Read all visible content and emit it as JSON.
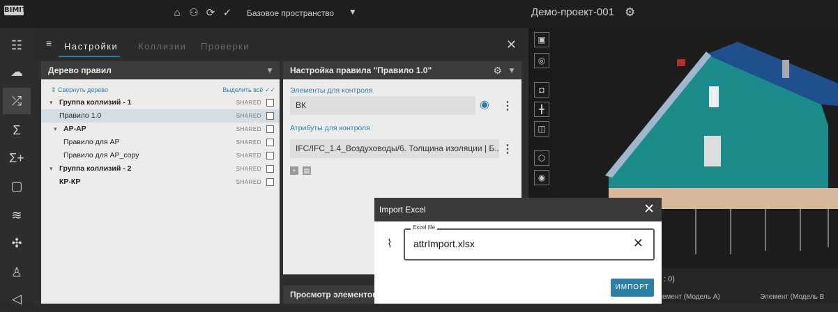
{
  "topbar": {
    "logo": "BIMIT",
    "icons": [
      "briefcase-icon",
      "org-chart-icon",
      "gear-cycle-icon",
      "check-circle-icon"
    ],
    "space_label": "Базовое пространство",
    "project_title": "Демо-проект-001"
  },
  "leftbar": {
    "items": [
      "tree-icon",
      "lightbulb-icon",
      "shuffle-icon",
      "sum-icon",
      "sum-plus-icon",
      "2d-icon",
      "chart-icon",
      "puzzle-icon",
      "user-check-icon",
      "send-icon"
    ]
  },
  "tabs": [
    {
      "label": "Настройки",
      "active": true
    },
    {
      "label": "Коллизии",
      "active": false
    },
    {
      "label": "Проверки",
      "active": false
    }
  ],
  "tree": {
    "title": "Дерево правил",
    "collapse_label": "Свернуть дерево",
    "select_all_label": "Выделить всё",
    "rows": [
      {
        "label": "Группа коллизий - 1",
        "shared": "SHARED"
      },
      {
        "label": "Правило 1.0",
        "shared": "SHARED"
      },
      {
        "label": "АР-АР",
        "shared": "SHARED"
      },
      {
        "label": "Правило для АР",
        "shared": "SHARED"
      },
      {
        "label": "Правило для АР_copy",
        "shared": "SHARED"
      },
      {
        "label": "Группа коллизий - 2",
        "shared": "SHARED"
      },
      {
        "label": "КР-КР",
        "shared": "SHARED"
      }
    ]
  },
  "rule": {
    "title": "Настройка правила \"Правило 1.0\"",
    "elements_label": "Элементы для контроля",
    "elements_value": "ВК",
    "attributes_label": "Атрибуты для контроля",
    "attributes_value": "IFC/IFC_1.4_Воздуховоды/6. Толщина изоляции | Б..."
  },
  "view_elements_title": "Просмотр элементов",
  "bottom_bar": {
    "count_text": ": 0)",
    "col1": "лемент (Модель А)",
    "col2": "Элемент (Модель В"
  },
  "modal": {
    "title": "Import Excel",
    "field_label": "Excel file",
    "file_value": "attrImport.xlsx",
    "import_label": "ИМПОРТ"
  },
  "colors": {
    "accent": "#2e7fa8",
    "house_wall": "#1a8c8c",
    "house_wall_alt": "#1f4f8c",
    "foundation": "#d8b898"
  }
}
